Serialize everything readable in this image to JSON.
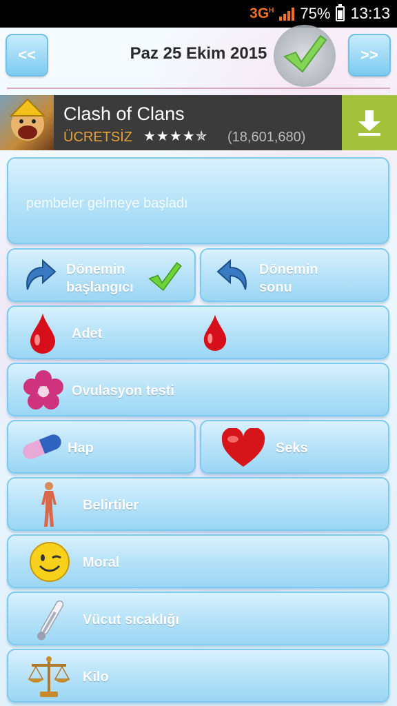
{
  "status_bar": {
    "network": "3G",
    "network_sub": "H",
    "battery": "75%",
    "time": "13:13"
  },
  "header": {
    "prev_label": "<<",
    "next_label": ">>",
    "date": "Paz 25 Ekim 2015"
  },
  "ad": {
    "title": "Clash of Clans",
    "price": "ÜCRETSİZ",
    "stars": "★★★★✯",
    "rating_count": "(18,601,680)"
  },
  "note": {
    "text": "pembeler gelmeye başladı"
  },
  "buttons": {
    "period_start_line1": "Dönemin",
    "period_start_line2": "başlangıcı",
    "period_end_line1": "Dönemin",
    "period_end_line2": "sonu",
    "menstruation": "Adet",
    "ovulation_test": "Ovulasyon testi",
    "pill": "Hap",
    "sex": "Seks",
    "symptoms": "Belirtiler",
    "mood": "Moral",
    "temperature": "Vücut sıcaklığı",
    "weight": "Kilo"
  },
  "colors": {
    "card_top": "#d9f1fd",
    "card_bottom": "#9bd6f4",
    "card_border": "#7ccaf0",
    "ad_bg": "#3b3b3b",
    "download_green": "#a4c23c",
    "price_orange": "#e8a13a"
  }
}
